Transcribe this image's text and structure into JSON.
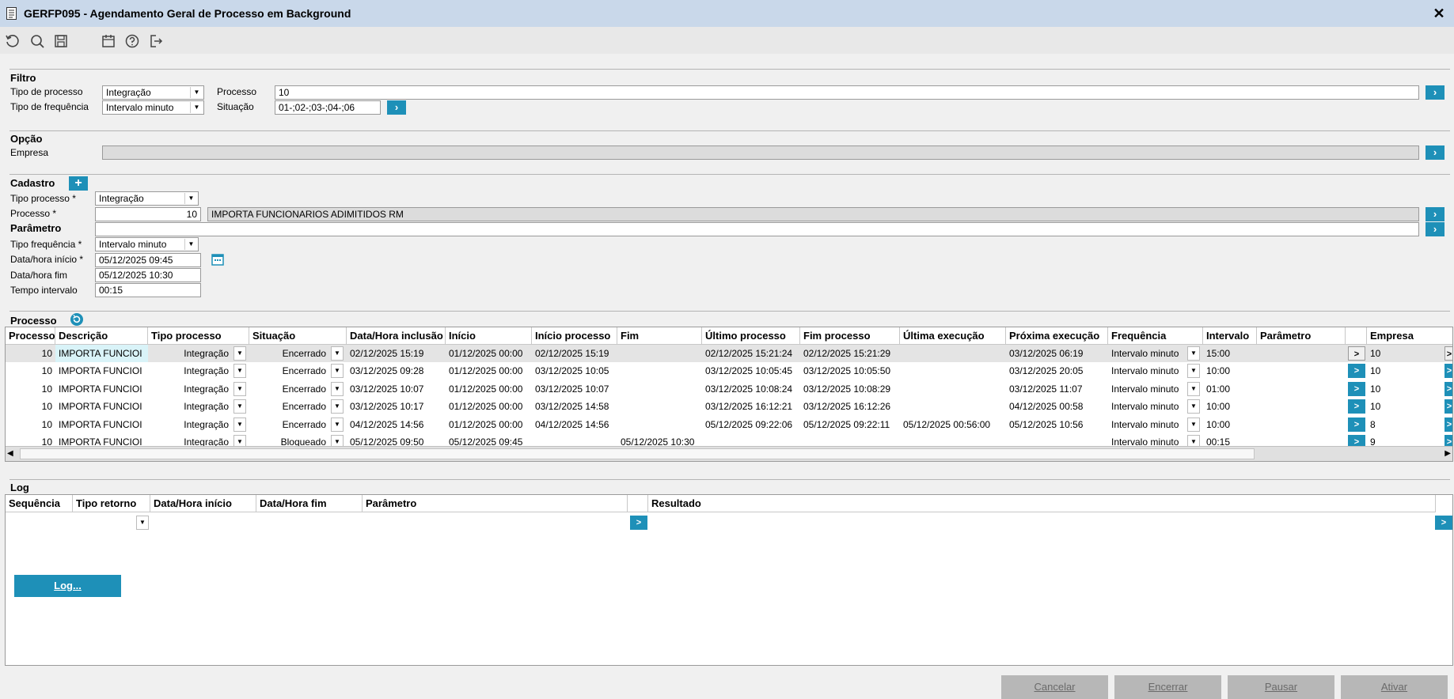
{
  "window": {
    "title": "GERFP095 - Agendamento Geral de Processo em Background",
    "close": "✕"
  },
  "toolbar": {
    "icons": [
      "refresh-icon",
      "search-icon",
      "save-icon",
      "calendar-icon",
      "help-icon",
      "exit-icon"
    ]
  },
  "filtro": {
    "title": "Filtro",
    "tipo_processo_label": "Tipo de processo",
    "tipo_processo_value": "Integração",
    "processo_label": "Processo",
    "processo_value": "10",
    "tipo_frequencia_label": "Tipo de frequência",
    "tipo_frequencia_value": "Intervalo minuto",
    "situacao_label": "Situação",
    "situacao_value": "01-;02-;03-;04-;06"
  },
  "opcao": {
    "title": "Opção",
    "empresa_label": "Empresa",
    "empresa_value": ""
  },
  "cadastro": {
    "title": "Cadastro",
    "tipo_processo_label": "Tipo processo *",
    "tipo_processo_value": "Integração",
    "processo_label": "Processo *",
    "processo_value": "10",
    "processo_desc": "IMPORTA FUNCIONARIOS ADIMITIDOS RM",
    "parametro_label": "Parâmetro",
    "parametro_value": "",
    "tipo_frequencia_label": "Tipo frequência *",
    "tipo_frequencia_value": "Intervalo minuto",
    "data_inicio_label": "Data/hora início *",
    "data_inicio_value": "05/12/2025 09:45",
    "data_fim_label": "Data/hora fim",
    "data_fim_value": "05/12/2025 10:30",
    "tempo_label": "Tempo intervalo",
    "tempo_value": "00:15"
  },
  "processo_grid": {
    "title": "Processo",
    "headers": [
      "Processo",
      "Descrição",
      "Tipo processo",
      "Situação",
      "Data/Hora inclusão",
      "Início",
      "Início processo",
      "Fim",
      "Último processo",
      "Fim processo",
      "Última execução",
      "Próxima execução",
      "Frequência",
      "Intervalo",
      "Parâmetro",
      "",
      "Empresa"
    ],
    "rows": [
      [
        "10",
        "IMPORTA FUNCIOI",
        "Integração",
        "Encerrado",
        "02/12/2025 15:19",
        "01/12/2025 00:00",
        "02/12/2025 15:19",
        "",
        "02/12/2025 15:21:24",
        "02/12/2025 15:21:29",
        "",
        "03/12/2025 06:19",
        "Intervalo minuto",
        "15:00",
        "",
        "10"
      ],
      [
        "10",
        "IMPORTA FUNCIOI",
        "Integração",
        "Encerrado",
        "03/12/2025 09:28",
        "01/12/2025 00:00",
        "03/12/2025 10:05",
        "",
        "03/12/2025 10:05:45",
        "03/12/2025 10:05:50",
        "",
        "03/12/2025 20:05",
        "Intervalo minuto",
        "10:00",
        "",
        "10"
      ],
      [
        "10",
        "IMPORTA FUNCIOI",
        "Integração",
        "Encerrado",
        "03/12/2025 10:07",
        "01/12/2025 00:00",
        "03/12/2025 10:07",
        "",
        "03/12/2025 10:08:24",
        "03/12/2025 10:08:29",
        "",
        "03/12/2025 11:07",
        "Intervalo minuto",
        "01:00",
        "",
        "10"
      ],
      [
        "10",
        "IMPORTA FUNCIOI",
        "Integração",
        "Encerrado",
        "03/12/2025 10:17",
        "01/12/2025 00:00",
        "03/12/2025 14:58",
        "",
        "03/12/2025 16:12:21",
        "03/12/2025 16:12:26",
        "",
        "04/12/2025 00:58",
        "Intervalo minuto",
        "10:00",
        "",
        "10"
      ],
      [
        "10",
        "IMPORTA FUNCIOI",
        "Integração",
        "Encerrado",
        "04/12/2025 14:56",
        "01/12/2025 00:00",
        "04/12/2025 14:56",
        "",
        "05/12/2025 09:22:06",
        "05/12/2025 09:22:11",
        "05/12/2025 00:56:00",
        "05/12/2025 10:56",
        "Intervalo minuto",
        "10:00",
        "",
        "8"
      ],
      [
        "10",
        "IMPORTA FUNCIOI",
        "Integração",
        "Bloqueado",
        "05/12/2025 09:50",
        "05/12/2025 09:45",
        "",
        "05/12/2025 10:30",
        "",
        "",
        "",
        "",
        "Intervalo minuto",
        "00:15",
        "",
        "9"
      ]
    ]
  },
  "log_grid": {
    "title": "Log",
    "headers": [
      "Sequência",
      "Tipo retorno",
      "Data/Hora início",
      "Data/Hora fim",
      "Parâmetro",
      "",
      "Resultado"
    ],
    "button": "Log..."
  },
  "footer": {
    "cancelar": "Cancelar",
    "encerrar": "Encerrar",
    "pausar": "Pausar",
    "ativar": "Ativar"
  },
  "colors": {
    "accent": "#1e90b8",
    "title_bar": "#c9d8ea"
  }
}
